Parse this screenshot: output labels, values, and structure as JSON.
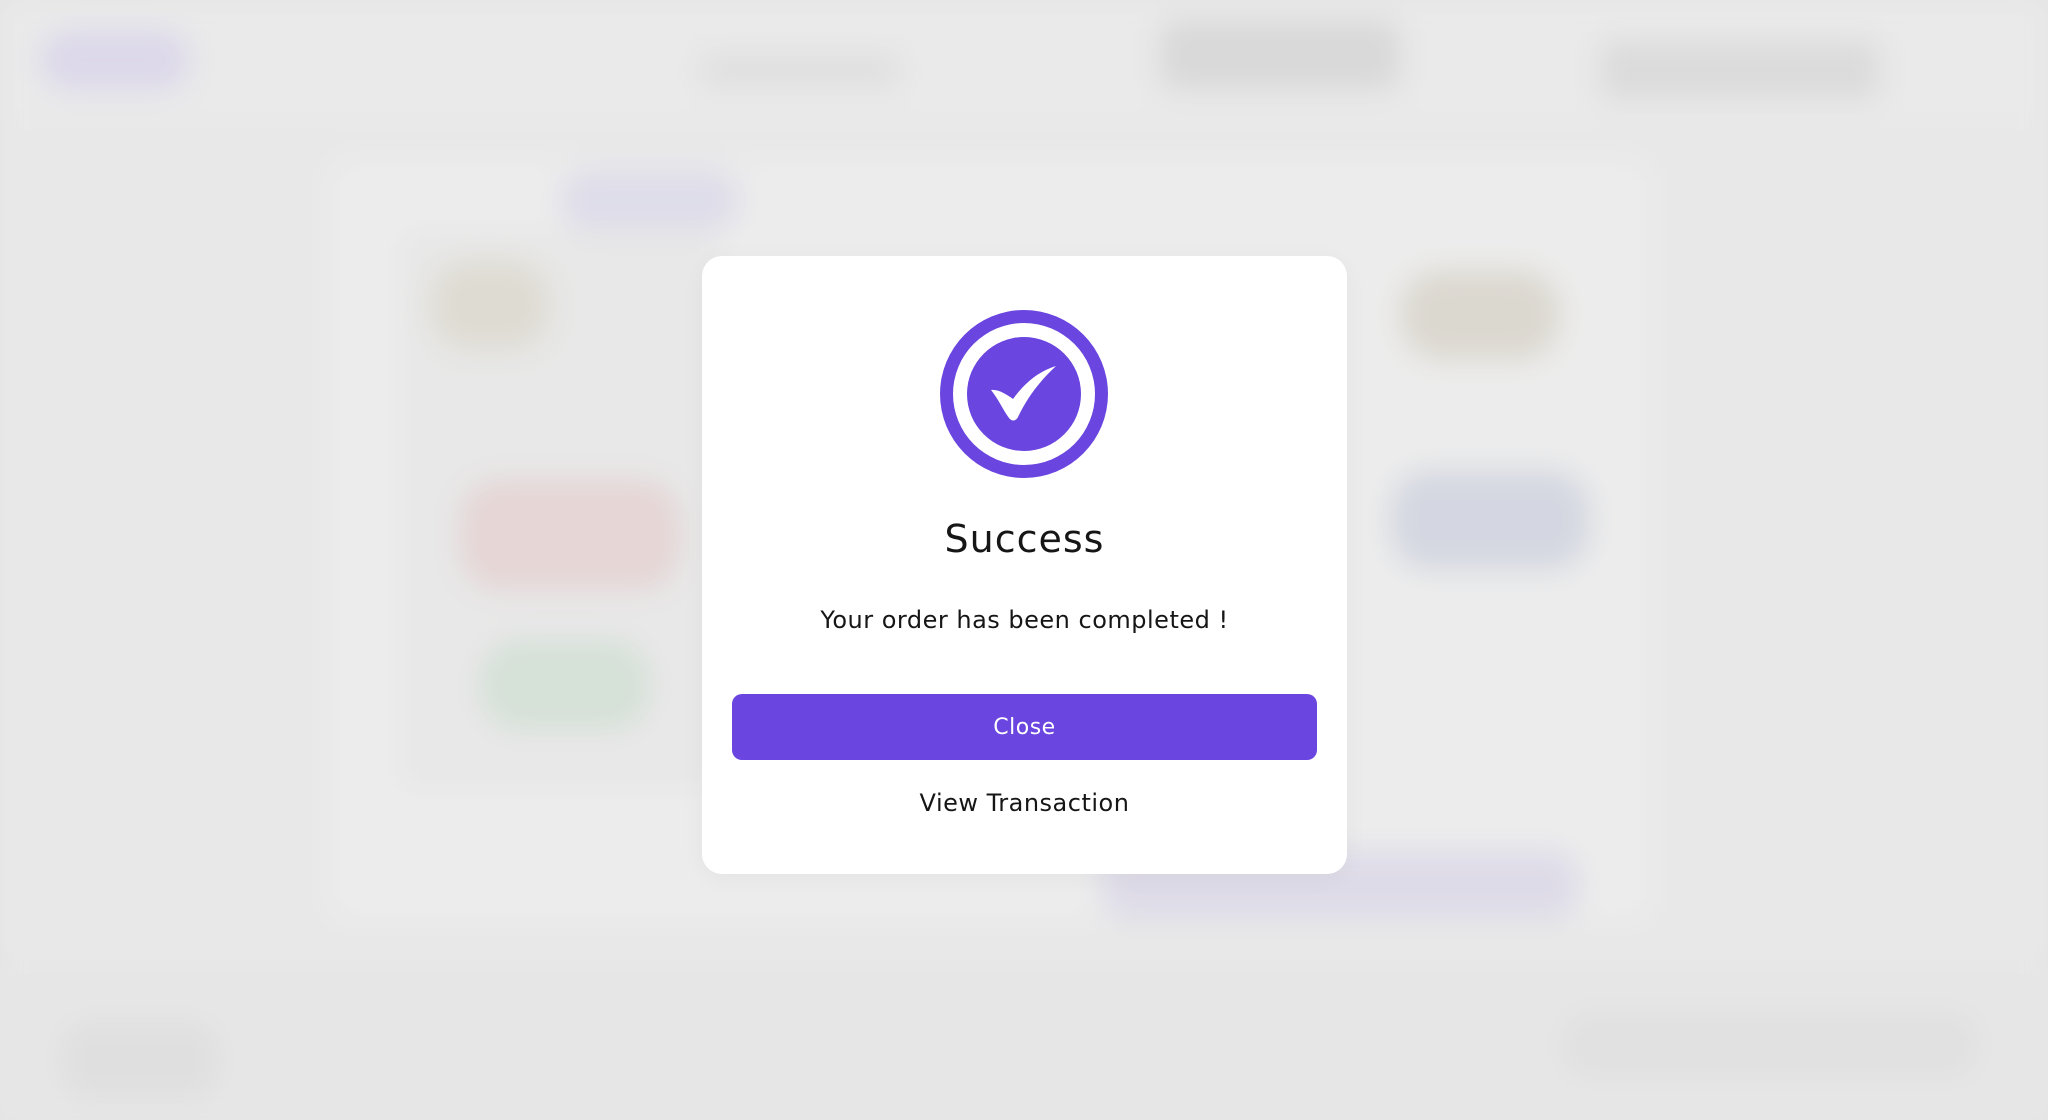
{
  "colors": {
    "accent": "#6a45e0",
    "modal_background": "#ffffff",
    "backdrop": "#e6e6e6",
    "text": "#161616"
  },
  "dialog": {
    "icon": "check-circle-icon",
    "title": "Success",
    "message": "Your order has been completed !",
    "primary_button_label": "Close",
    "secondary_link_label": "View Transaction"
  }
}
